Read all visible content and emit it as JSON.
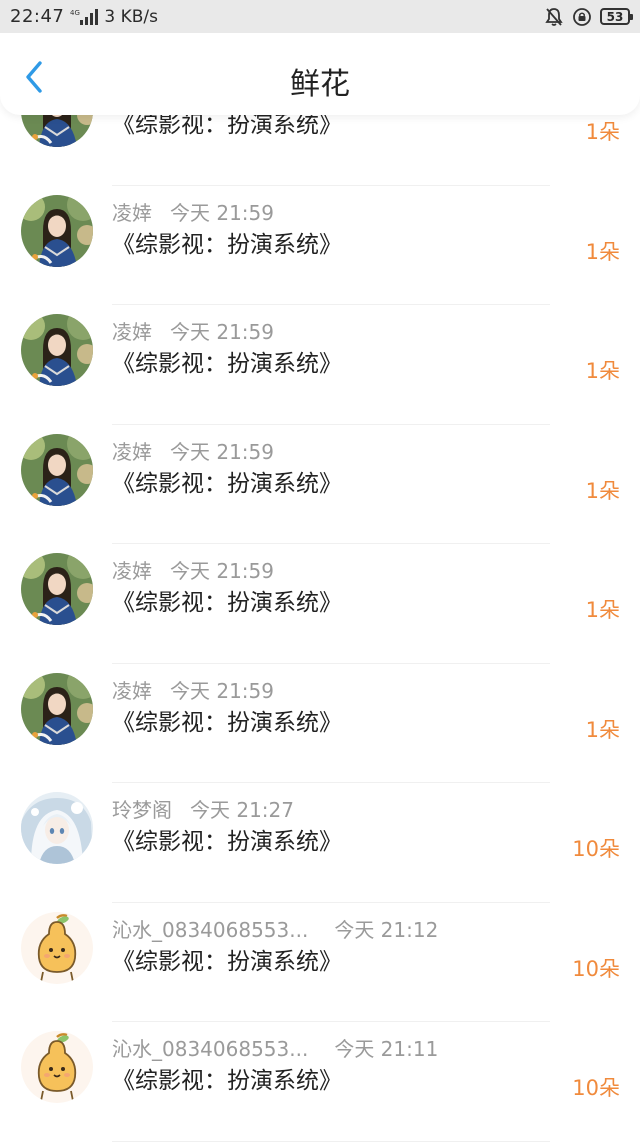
{
  "status_bar": {
    "time": "22:47",
    "network_type": "4G",
    "speed": "3 KB/s",
    "battery": "53"
  },
  "nav": {
    "title": "鲜花"
  },
  "colors": {
    "accent_blue": "#2f9ae6",
    "count_orange": "#f08a3c"
  },
  "items": [
    {
      "name": "",
      "time": "",
      "book": "《综影视：扮演系统》",
      "count": "1朵",
      "avatar": "girl"
    },
    {
      "name": "凌婞",
      "time": "今天 21:59",
      "book": "《综影视：扮演系统》",
      "count": "1朵",
      "avatar": "girl"
    },
    {
      "name": "凌婞",
      "time": "今天 21:59",
      "book": "《综影视：扮演系统》",
      "count": "1朵",
      "avatar": "girl"
    },
    {
      "name": "凌婞",
      "time": "今天 21:59",
      "book": "《综影视：扮演系统》",
      "count": "1朵",
      "avatar": "girl"
    },
    {
      "name": "凌婞",
      "time": "今天 21:59",
      "book": "《综影视：扮演系统》",
      "count": "1朵",
      "avatar": "girl"
    },
    {
      "name": "凌婞",
      "time": "今天 21:59",
      "book": "《综影视：扮演系统》",
      "count": "1朵",
      "avatar": "girl"
    },
    {
      "name": "玲梦阁",
      "time": "今天 21:27",
      "book": "《综影视：扮演系统》",
      "count": "10朵",
      "avatar": "anime"
    },
    {
      "name": "沁水_0834068553...",
      "time": "今天 21:12",
      "book": "《综影视：扮演系统》",
      "count": "10朵",
      "avatar": "pear"
    },
    {
      "name": "沁水_0834068553...",
      "time": "今天 21:11",
      "book": "《综影视：扮演系统》",
      "count": "10朵",
      "avatar": "pear"
    }
  ]
}
